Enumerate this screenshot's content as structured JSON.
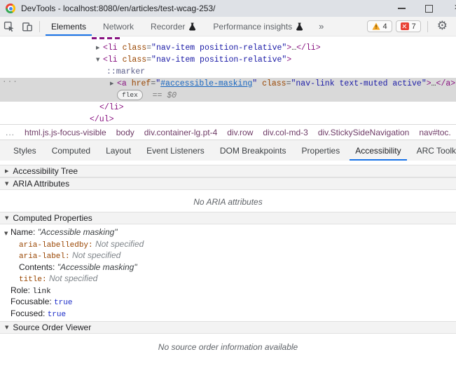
{
  "window": {
    "title": "DevTools - localhost:8080/en/articles/test-wcag-253/"
  },
  "icons": {
    "collapsed_arrow": "▶",
    "expanded_arrow": "▼",
    "gear": "⚙",
    "more_tabs": "»",
    "gutter_ellipsis": "...",
    "overflow_ellipsis": "..."
  },
  "toolbar": {
    "tabs": [
      {
        "label": "Elements",
        "active": true
      },
      {
        "label": "Network",
        "active": false
      },
      {
        "label": "Recorder",
        "active": false
      },
      {
        "label": "Performance insights",
        "active": false
      }
    ],
    "warning_count": "4",
    "error_count": "7"
  },
  "dom_tree": {
    "eq": "=",
    "gt": ">",
    "ellipsis": "…",
    "li_collapsed": {
      "open": "<li",
      "attr": " class",
      "value": "\"nav-item position-relative\"",
      "close": "</li>"
    },
    "li_expanded": {
      "open": "<li",
      "attr": " class",
      "value": "\"nav-item position-relative\""
    },
    "pseudo_marker": "::marker",
    "anchor": {
      "open": "<a",
      "href_attr": " href",
      "quote": "\"",
      "href_value": "#accessible-masking",
      "class_attr": " class",
      "class_value": "\"nav-link text-muted active\"",
      "close": "</a>"
    },
    "flex_badge": "flex",
    "equals_equals": "==",
    "dollar_zero": "$0",
    "li_close": "</li>",
    "ul_close": "</ul>"
  },
  "breadcrumbs": {
    "items": [
      "html.js.js-focus-visible",
      "body",
      "div.container-lg.pt-4",
      "div.row",
      "div.col-md-3",
      "div.StickySideNavigation",
      "nav#toc."
    ]
  },
  "panel_tabs": {
    "items": [
      {
        "label": "Styles",
        "active": false
      },
      {
        "label": "Computed",
        "active": false
      },
      {
        "label": "Layout",
        "active": false
      },
      {
        "label": "Event Listeners",
        "active": false
      },
      {
        "label": "DOM Breakpoints",
        "active": false
      },
      {
        "label": "Properties",
        "active": false
      },
      {
        "label": "Accessibility",
        "active": true
      },
      {
        "label": "ARC Toolkit",
        "active": false
      }
    ]
  },
  "accessibility": {
    "tree_section": {
      "label": "Accessibility Tree"
    },
    "aria_section": {
      "label": "ARIA Attributes",
      "empty_message": "No ARIA attributes"
    },
    "computed_section": {
      "label": "Computed Properties"
    },
    "source_order_section": {
      "label": "Source Order Viewer",
      "empty_message": "No source order information available"
    },
    "computed": {
      "name_label": "Name:",
      "name_value": "\"Accessible masking\"",
      "child_rows": [
        {
          "name": "aria-labelledby:",
          "value": "Not specified"
        },
        {
          "name": "aria-label:",
          "value": "Not specified"
        },
        {
          "name": "Contents:",
          "value": "\"Accessible masking\""
        },
        {
          "name": "title:",
          "value": "Not specified"
        }
      ],
      "role_label": "Role:",
      "role_value": "link",
      "focusable_label": "Focusable:",
      "focusable_value": "true",
      "focused_label": "Focused:",
      "focused_value": "true"
    }
  },
  "colors": {
    "accent": "#1a73e8",
    "warning": "#f5a623",
    "error": "#e94235",
    "tag": "#881280",
    "attribute": "#994500",
    "attr_value": "#1a1aa6",
    "link": "#1665c0",
    "selection": "#d9d9d9"
  }
}
